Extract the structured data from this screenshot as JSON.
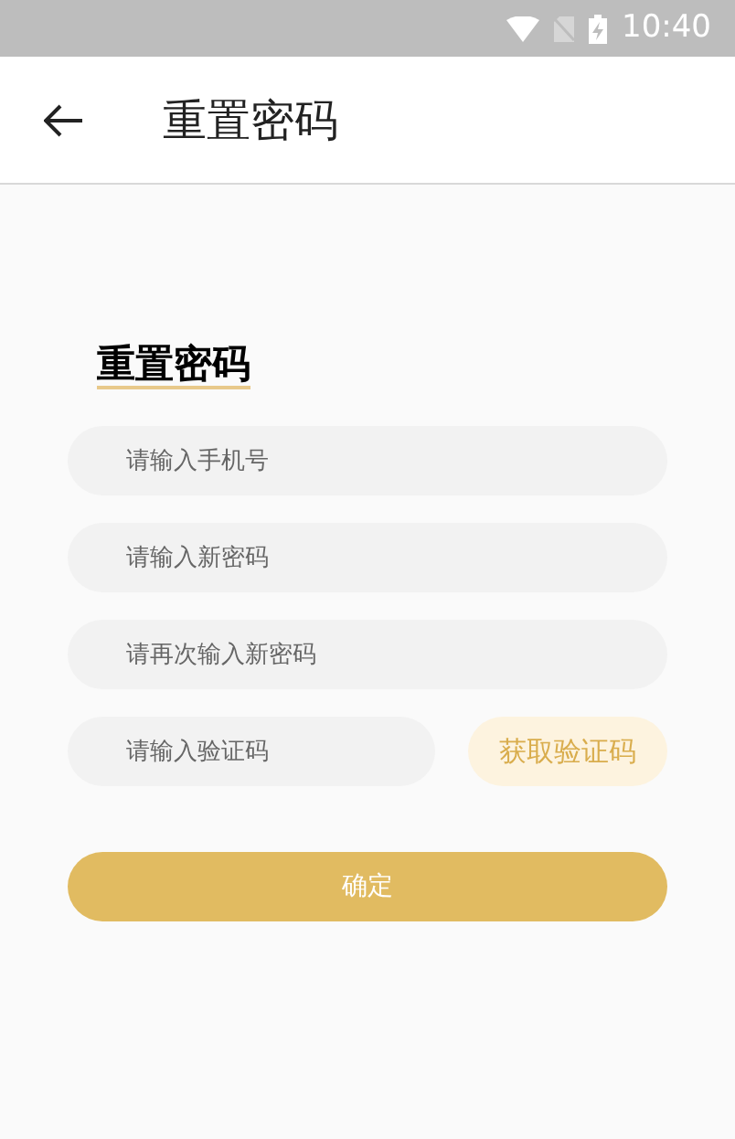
{
  "status_bar": {
    "time": "10:40"
  },
  "app_bar": {
    "title": "重置密码"
  },
  "form": {
    "heading": "重置密码",
    "fields": [
      {
        "placeholder": "请输入手机号"
      },
      {
        "placeholder": "请输入新密码"
      },
      {
        "placeholder": "请再次输入新密码"
      }
    ],
    "code_field": {
      "placeholder": "请输入验证码"
    },
    "code_button": "获取验证码",
    "submit_button": "确定"
  }
}
